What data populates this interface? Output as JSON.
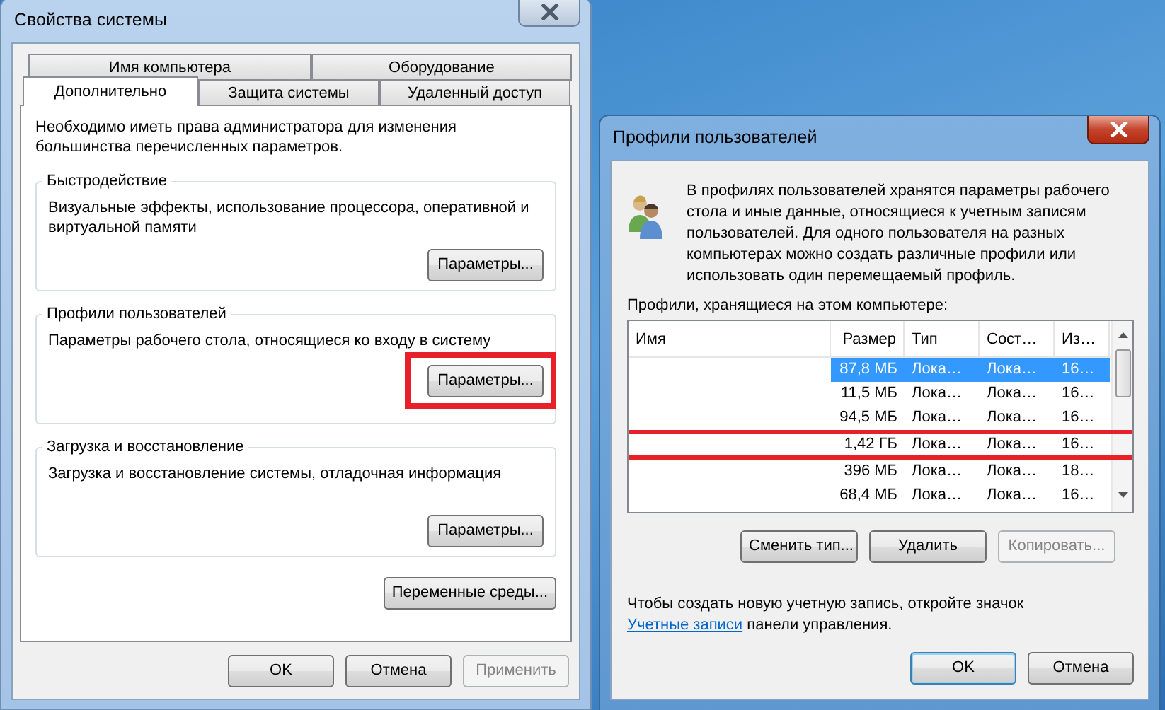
{
  "system_properties": {
    "title": "Свойства системы",
    "tab_rows": [
      [
        {
          "label": "Имя компьютера",
          "selected": false
        },
        {
          "label": "Оборудование",
          "selected": false
        }
      ],
      [
        {
          "label": "Дополнительно",
          "selected": true
        },
        {
          "label": "Защита системы",
          "selected": false
        },
        {
          "label": "Удаленный доступ",
          "selected": false
        }
      ]
    ],
    "notice": "Необходимо иметь права администратора для изменения большинства перечисленных параметров.",
    "groups": [
      {
        "title": "Быстродействие",
        "description": "Визуальные эффекты, использование процессора, оперативной и виртуальной памяти",
        "button": "Параметры...",
        "highlighted": false
      },
      {
        "title": "Профили пользователей",
        "description": "Параметры рабочего стола, относящиеся ко входу в систему",
        "button": "Параметры...",
        "highlighted": true
      },
      {
        "title": "Загрузка и восстановление",
        "description": "Загрузка и восстановление системы, отладочная информация",
        "button": "Параметры...",
        "highlighted": false
      }
    ],
    "env_button": "Переменные среды...",
    "buttons": [
      {
        "label": "OK",
        "disabled": false
      },
      {
        "label": "Отмена",
        "disabled": false
      },
      {
        "label": "Применить",
        "disabled": true
      }
    ]
  },
  "user_profiles": {
    "title": "Профили пользователей",
    "description": "В профилях пользователей хранятся параметры рабочего стола и иные данные, относящиеся к учетным записям пользователей. Для одного пользователя на разных компьютерах можно создать различные профили или использовать один перемещаемый профиль.",
    "list_label": "Профили, хранящиеся на этом компьютере:",
    "columns": [
      "Имя",
      "Размер",
      "Тип",
      "Сост…",
      "Из…"
    ],
    "rows": [
      {
        "size": "87,8 МБ",
        "type": "Лока…",
        "status": "Лока…",
        "modified": "16…",
        "selected": true,
        "highlighted": false
      },
      {
        "size": "11,5 МБ",
        "type": "Лока…",
        "status": "Лока…",
        "modified": "16…",
        "selected": false,
        "highlighted": false
      },
      {
        "size": "94,5 МБ",
        "type": "Лока…",
        "status": "Лока…",
        "modified": "16…",
        "selected": false,
        "highlighted": false
      },
      {
        "size": "1,42 ГБ",
        "type": "Лока…",
        "status": "Лока…",
        "modified": "16…",
        "selected": false,
        "highlighted": true
      },
      {
        "size": "396 МБ",
        "type": "Лока…",
        "status": "Лока…",
        "modified": "18…",
        "selected": false,
        "highlighted": false
      },
      {
        "size": "68,4 МБ",
        "type": "Лока…",
        "status": "Лока…",
        "modified": "16…",
        "selected": false,
        "highlighted": false
      }
    ],
    "action_buttons": [
      {
        "label": "Сменить тип...",
        "disabled": false
      },
      {
        "label": "Удалить",
        "disabled": false
      },
      {
        "label": "Копировать...",
        "disabled": true
      }
    ],
    "footer_before": "Чтобы создать новую учетную запись, откройте значок",
    "footer_link": "Учетные записи",
    "footer_after": "панели управления.",
    "buttons": [
      {
        "label": "OK",
        "disabled": false
      },
      {
        "label": "Отмена",
        "disabled": false
      }
    ]
  }
}
